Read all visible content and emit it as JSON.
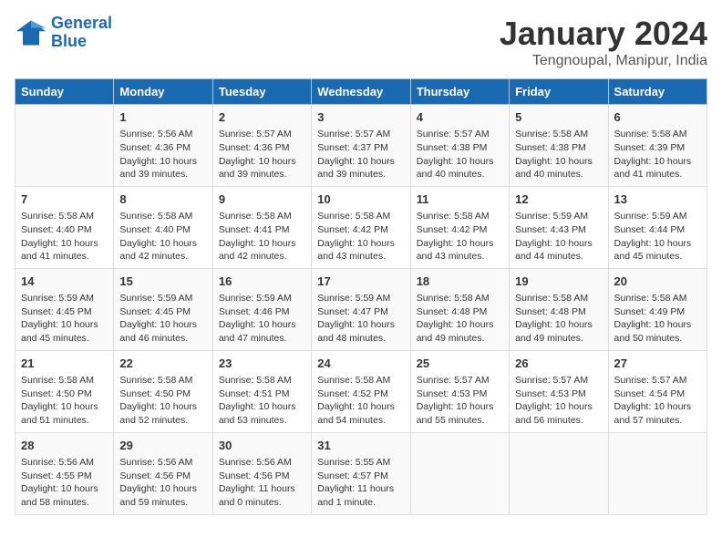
{
  "logo": {
    "line1": "General",
    "line2": "Blue"
  },
  "title": "January 2024",
  "subtitle": "Tengnoupal, Manipur, India",
  "days_of_week": [
    "Sunday",
    "Monday",
    "Tuesday",
    "Wednesday",
    "Thursday",
    "Friday",
    "Saturday"
  ],
  "weeks": [
    [
      {
        "num": "",
        "info": ""
      },
      {
        "num": "1",
        "info": "Sunrise: 5:56 AM\nSunset: 4:36 PM\nDaylight: 10 hours\nand 39 minutes."
      },
      {
        "num": "2",
        "info": "Sunrise: 5:57 AM\nSunset: 4:36 PM\nDaylight: 10 hours\nand 39 minutes."
      },
      {
        "num": "3",
        "info": "Sunrise: 5:57 AM\nSunset: 4:37 PM\nDaylight: 10 hours\nand 39 minutes."
      },
      {
        "num": "4",
        "info": "Sunrise: 5:57 AM\nSunset: 4:38 PM\nDaylight: 10 hours\nand 40 minutes."
      },
      {
        "num": "5",
        "info": "Sunrise: 5:58 AM\nSunset: 4:38 PM\nDaylight: 10 hours\nand 40 minutes."
      },
      {
        "num": "6",
        "info": "Sunrise: 5:58 AM\nSunset: 4:39 PM\nDaylight: 10 hours\nand 41 minutes."
      }
    ],
    [
      {
        "num": "7",
        "info": "Sunrise: 5:58 AM\nSunset: 4:40 PM\nDaylight: 10 hours\nand 41 minutes."
      },
      {
        "num": "8",
        "info": "Sunrise: 5:58 AM\nSunset: 4:40 PM\nDaylight: 10 hours\nand 42 minutes."
      },
      {
        "num": "9",
        "info": "Sunrise: 5:58 AM\nSunset: 4:41 PM\nDaylight: 10 hours\nand 42 minutes."
      },
      {
        "num": "10",
        "info": "Sunrise: 5:58 AM\nSunset: 4:42 PM\nDaylight: 10 hours\nand 43 minutes."
      },
      {
        "num": "11",
        "info": "Sunrise: 5:58 AM\nSunset: 4:42 PM\nDaylight: 10 hours\nand 43 minutes."
      },
      {
        "num": "12",
        "info": "Sunrise: 5:59 AM\nSunset: 4:43 PM\nDaylight: 10 hours\nand 44 minutes."
      },
      {
        "num": "13",
        "info": "Sunrise: 5:59 AM\nSunset: 4:44 PM\nDaylight: 10 hours\nand 45 minutes."
      }
    ],
    [
      {
        "num": "14",
        "info": "Sunrise: 5:59 AM\nSunset: 4:45 PM\nDaylight: 10 hours\nand 45 minutes."
      },
      {
        "num": "15",
        "info": "Sunrise: 5:59 AM\nSunset: 4:45 PM\nDaylight: 10 hours\nand 46 minutes."
      },
      {
        "num": "16",
        "info": "Sunrise: 5:59 AM\nSunset: 4:46 PM\nDaylight: 10 hours\nand 47 minutes."
      },
      {
        "num": "17",
        "info": "Sunrise: 5:59 AM\nSunset: 4:47 PM\nDaylight: 10 hours\nand 48 minutes."
      },
      {
        "num": "18",
        "info": "Sunrise: 5:58 AM\nSunset: 4:48 PM\nDaylight: 10 hours\nand 49 minutes."
      },
      {
        "num": "19",
        "info": "Sunrise: 5:58 AM\nSunset: 4:48 PM\nDaylight: 10 hours\nand 49 minutes."
      },
      {
        "num": "20",
        "info": "Sunrise: 5:58 AM\nSunset: 4:49 PM\nDaylight: 10 hours\nand 50 minutes."
      }
    ],
    [
      {
        "num": "21",
        "info": "Sunrise: 5:58 AM\nSunset: 4:50 PM\nDaylight: 10 hours\nand 51 minutes."
      },
      {
        "num": "22",
        "info": "Sunrise: 5:58 AM\nSunset: 4:50 PM\nDaylight: 10 hours\nand 52 minutes."
      },
      {
        "num": "23",
        "info": "Sunrise: 5:58 AM\nSunset: 4:51 PM\nDaylight: 10 hours\nand 53 minutes."
      },
      {
        "num": "24",
        "info": "Sunrise: 5:58 AM\nSunset: 4:52 PM\nDaylight: 10 hours\nand 54 minutes."
      },
      {
        "num": "25",
        "info": "Sunrise: 5:57 AM\nSunset: 4:53 PM\nDaylight: 10 hours\nand 55 minutes."
      },
      {
        "num": "26",
        "info": "Sunrise: 5:57 AM\nSunset: 4:53 PM\nDaylight: 10 hours\nand 56 minutes."
      },
      {
        "num": "27",
        "info": "Sunrise: 5:57 AM\nSunset: 4:54 PM\nDaylight: 10 hours\nand 57 minutes."
      }
    ],
    [
      {
        "num": "28",
        "info": "Sunrise: 5:56 AM\nSunset: 4:55 PM\nDaylight: 10 hours\nand 58 minutes."
      },
      {
        "num": "29",
        "info": "Sunrise: 5:56 AM\nSunset: 4:56 PM\nDaylight: 10 hours\nand 59 minutes."
      },
      {
        "num": "30",
        "info": "Sunrise: 5:56 AM\nSunset: 4:56 PM\nDaylight: 11 hours\nand 0 minutes."
      },
      {
        "num": "31",
        "info": "Sunrise: 5:55 AM\nSunset: 4:57 PM\nDaylight: 11 hours\nand 1 minute."
      },
      {
        "num": "",
        "info": ""
      },
      {
        "num": "",
        "info": ""
      },
      {
        "num": "",
        "info": ""
      }
    ]
  ]
}
